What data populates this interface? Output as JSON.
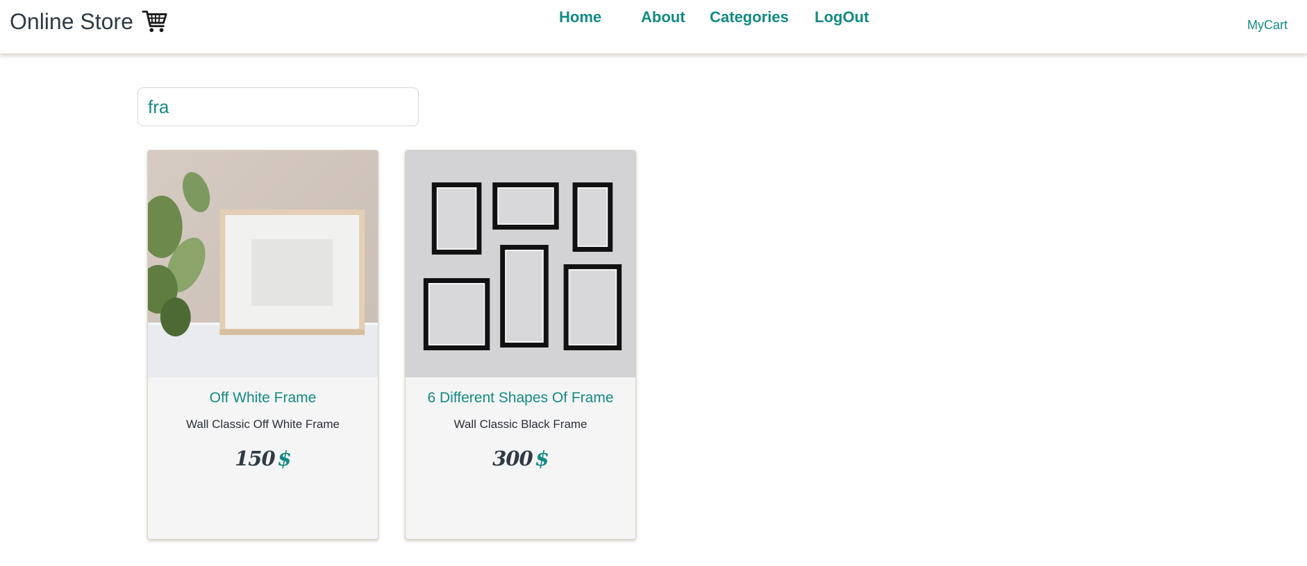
{
  "brand": {
    "name": "Online Store",
    "icon": "shopping-cart-icon"
  },
  "nav": {
    "home": "Home",
    "about": "About",
    "categories": "Categories",
    "logout": "LogOut",
    "mycart": "MyCart"
  },
  "search": {
    "value": "fra"
  },
  "colors": {
    "accent": "#128a84",
    "text_dark": "#2f3a44"
  },
  "products": [
    {
      "title": "Off White Frame",
      "description": "Wall Classic Off White Frame",
      "price": "150",
      "currency": "$"
    },
    {
      "title": "6 Different Shapes Of Frame",
      "description": "Wall Classic Black Frame",
      "price": "300",
      "currency": "$"
    }
  ]
}
